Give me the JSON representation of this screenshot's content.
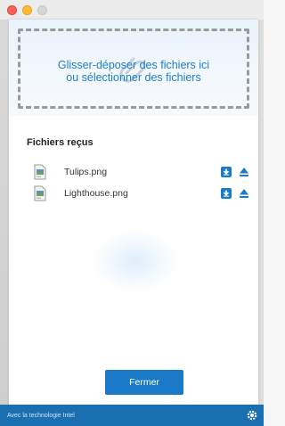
{
  "window": {
    "controls": [
      "close",
      "minimize",
      "zoom"
    ]
  },
  "dropzone": {
    "line1": "Glisser-déposer des fichiers ici",
    "line2": "ou sélectionner des fichiers",
    "icon": "paperclip-icon"
  },
  "received": {
    "title": "Fichiers reçus",
    "files": [
      {
        "name": "Tulips.png",
        "icon": "image-file-icon"
      },
      {
        "name": "Lighthouse.png",
        "icon": "image-file-icon"
      }
    ]
  },
  "actions": {
    "close_label": "Fermer"
  },
  "footer": {
    "text": "Avec la technologie Intel",
    "icon": "gear-icon"
  },
  "colors": {
    "accent": "#1b7ac8",
    "footer": "#1a6fb0",
    "drop_text": "#1e7fc5"
  }
}
